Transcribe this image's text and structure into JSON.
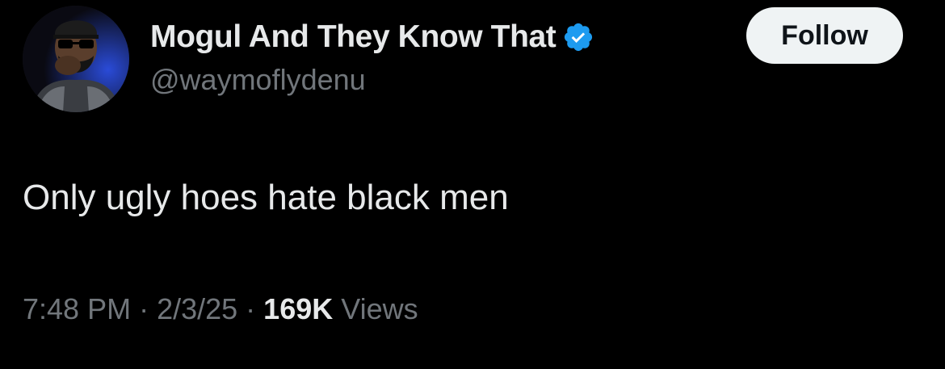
{
  "author": {
    "display_name": "Mogul And They Know That",
    "handle": "@waymoflydenu",
    "verified": true,
    "avatar_icon": "profile-photo",
    "verified_icon": "verified-badge-icon"
  },
  "follow_button": {
    "label": "Follow"
  },
  "tweet": {
    "text": "Only ugly hoes hate black men"
  },
  "meta": {
    "time": "7:48 PM",
    "separator": "·",
    "date": "2/3/25",
    "views_count": "169K",
    "views_label": "Views"
  },
  "colors": {
    "background": "#000000",
    "primary_text": "#e7e9ea",
    "secondary_text": "#71767b",
    "verified_blue": "#1d9bf0",
    "follow_button_bg": "#eff3f4",
    "follow_button_text": "#0f1419"
  }
}
